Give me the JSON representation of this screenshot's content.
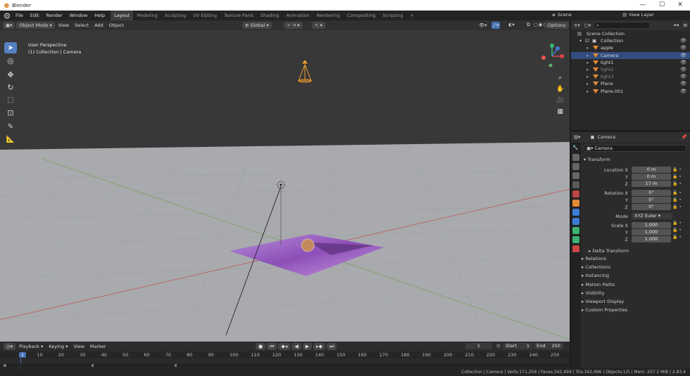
{
  "window": {
    "title": "Blender",
    "controls": [
      "—",
      "☐",
      "✕"
    ]
  },
  "menu": [
    "File",
    "Edit",
    "Render",
    "Window",
    "Help"
  ],
  "workspaces": [
    "Layout",
    "Modeling",
    "Sculpting",
    "UV Editing",
    "Texture Paint",
    "Shading",
    "Animation",
    "Rendering",
    "Compositing",
    "Scripting",
    "+"
  ],
  "active_workspace": "Layout",
  "scene": {
    "name": "Scene",
    "view_layer": "View Layer"
  },
  "viewport_header": {
    "mode": "Object Mode",
    "menus": [
      "View",
      "Select",
      "Add",
      "Object"
    ],
    "orientation": "Global",
    "options": "Options"
  },
  "viewport": {
    "perspective": "User Perspective",
    "collection_info": "(1) Collection | Camera"
  },
  "outliner": {
    "root": "Scene Collection",
    "collection": "Collection",
    "items": [
      {
        "name": "apple",
        "selected": false,
        "dim": false
      },
      {
        "name": "Camera",
        "selected": true,
        "dim": false
      },
      {
        "name": "light1",
        "selected": false,
        "dim": false
      },
      {
        "name": "light2",
        "selected": false,
        "dim": true
      },
      {
        "name": "light3",
        "selected": false,
        "dim": true
      },
      {
        "name": "Plane",
        "selected": false,
        "dim": false
      },
      {
        "name": "Plane.001",
        "selected": false,
        "dim": false
      }
    ]
  },
  "properties": {
    "object_name": "Camera",
    "object_field": "Camera",
    "transform_title": "Transform",
    "location": {
      "label": "Location X",
      "x": "0 m",
      "y": "0 m",
      "z": "17 m"
    },
    "rotation": {
      "label": "Rotation X",
      "x": "0°",
      "y": "0°",
      "z": "0°"
    },
    "mode": {
      "label": "Mode",
      "value": "XYZ Euler"
    },
    "scale": {
      "label": "Scale X",
      "x": "1.000",
      "y": "1.000",
      "z": "1.000"
    },
    "axis_y": "Y",
    "axis_z": "Z",
    "delta": "Delta Transform",
    "panels": [
      "Relations",
      "Collections",
      "Instancing",
      "Motion Paths",
      "Visibility",
      "Viewport Display",
      "Custom Properties"
    ]
  },
  "timeline": {
    "menus": [
      "Playback",
      "Keying",
      "View",
      "Marker"
    ],
    "current_frame": "1",
    "start_label": "Start",
    "start": "1",
    "end_label": "End",
    "end": "250",
    "ticks": [
      "1",
      "10",
      "20",
      "30",
      "40",
      "50",
      "60",
      "70",
      "80",
      "90",
      "100",
      "110",
      "120",
      "130",
      "140",
      "150",
      "160",
      "170",
      "180",
      "190",
      "200",
      "210",
      "220",
      "230",
      "240",
      "250"
    ]
  },
  "status": "Collection | Camera | Verts:171,256 | Faces:342,494 | Tris:342,496 | Objects:1/5 | Mem: 207.2 MiB | 2.83.4"
}
